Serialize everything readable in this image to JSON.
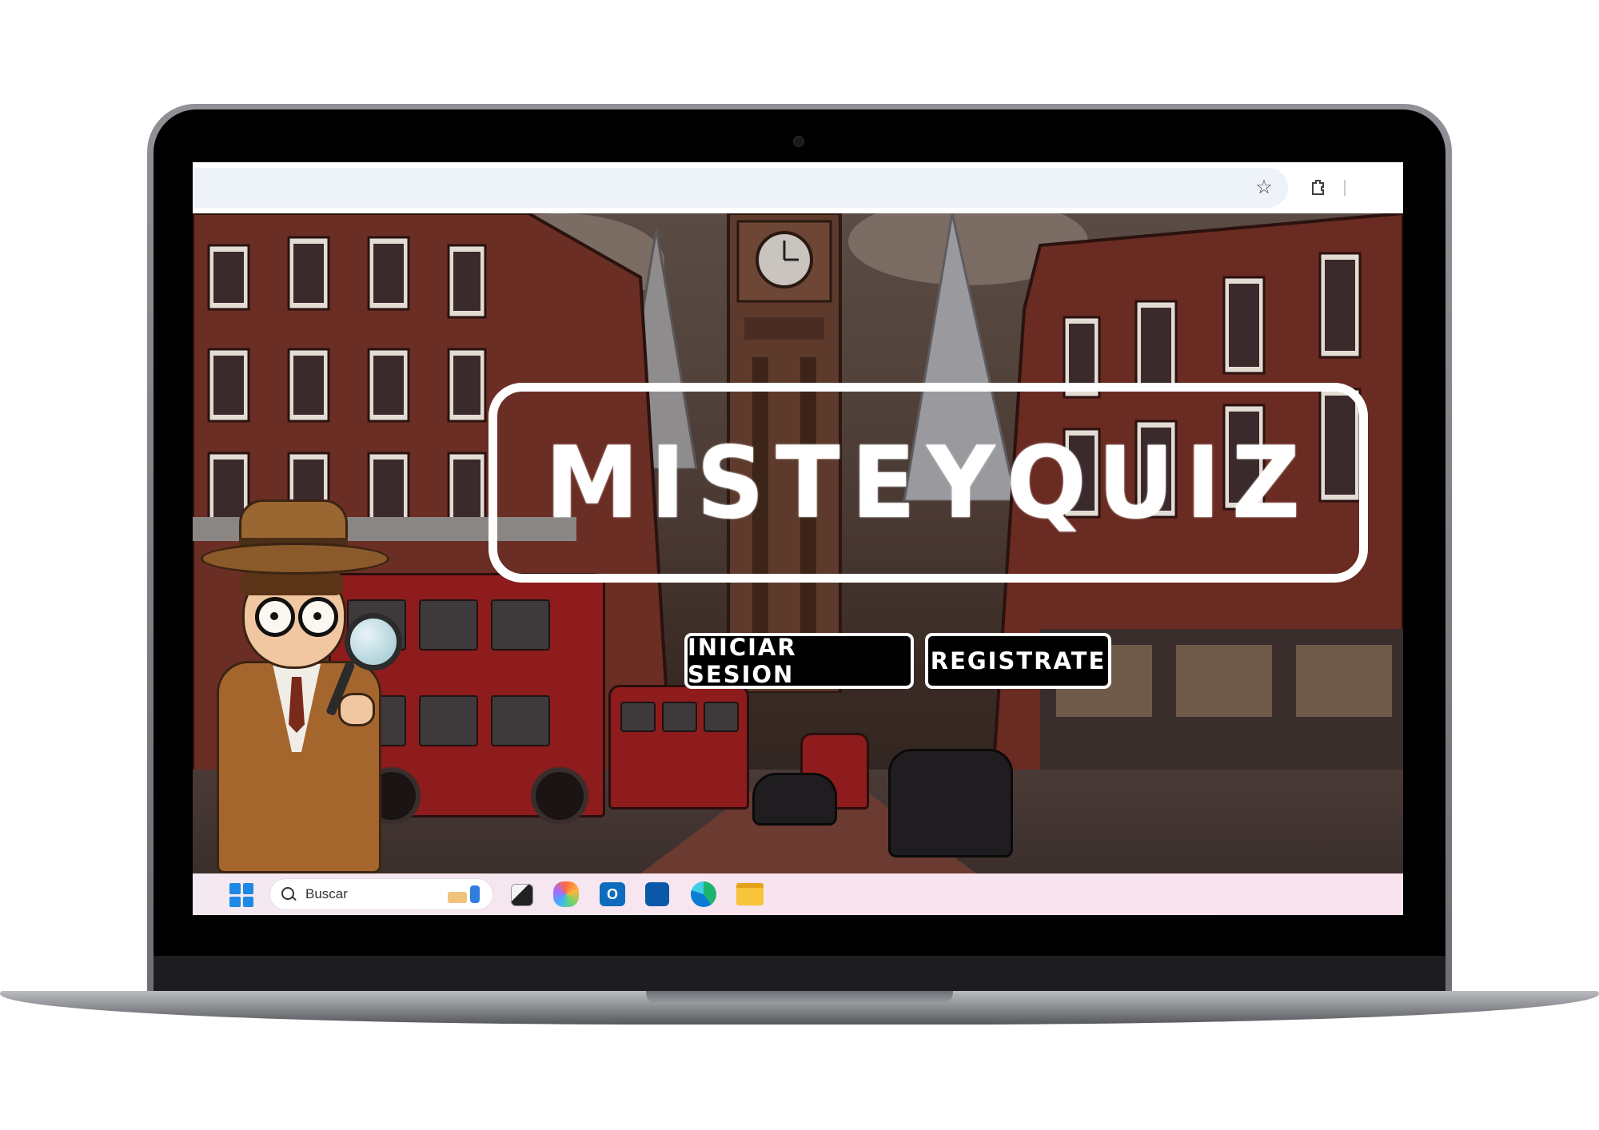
{
  "hero": {
    "logo": "MISTEYQUIZ",
    "login_label": "INICIAR SESION",
    "register_label": "REGISTRATE"
  },
  "browser": {
    "icons": [
      "star-icon",
      "extensions-icon"
    ]
  },
  "taskbar": {
    "search_label": "Buscar",
    "icons": [
      "windows-start-icon",
      "task-view-icon",
      "copilot-icon",
      "outlook-icon",
      "microsoft-store-icon",
      "edge-icon",
      "file-explorer-icon"
    ]
  },
  "colors": {
    "button_bg": "#000000",
    "button_text": "#ffffff",
    "logo": "#ffffff",
    "browser_bar": "#eef2f9",
    "taskbar": "#f8e4ef"
  }
}
